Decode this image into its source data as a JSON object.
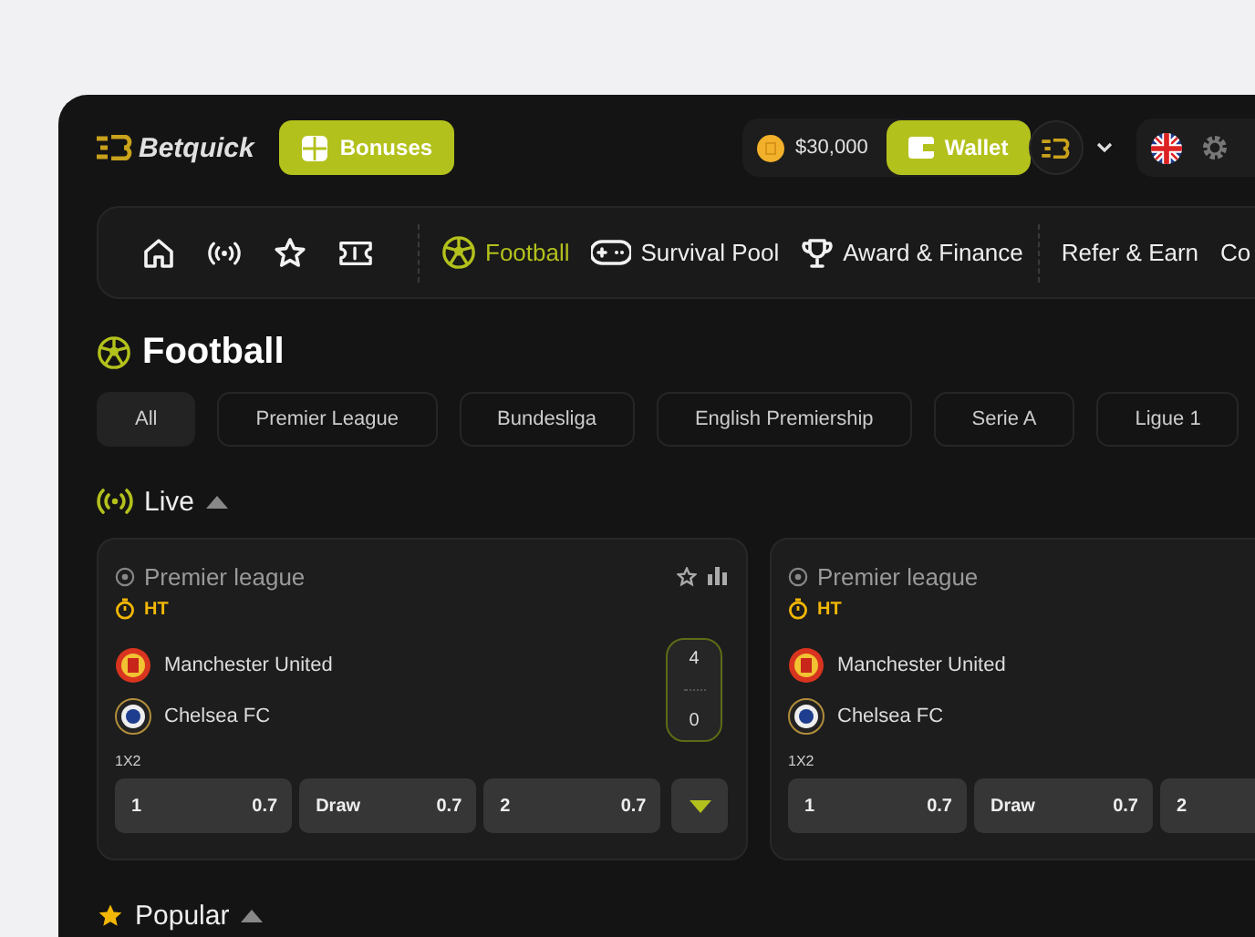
{
  "brand": {
    "name": "Betquick"
  },
  "header": {
    "bonuses_label": "Bonuses",
    "balance": "$30,000",
    "wallet_label": "Wallet"
  },
  "nav": {
    "icon_items": [
      {
        "kind": "home",
        "selected": false
      },
      {
        "kind": "live",
        "selected": false
      },
      {
        "kind": "star",
        "selected": false
      },
      {
        "kind": "ticket",
        "selected": false
      }
    ],
    "sport_items": [
      {
        "kind": "ball",
        "label": "Football",
        "selected": true
      },
      {
        "kind": "gamepad",
        "label": "Survival Pool",
        "selected": false
      },
      {
        "kind": "trophy",
        "label": "Award & Finance",
        "selected": false
      }
    ],
    "more_items": [
      {
        "label": "Refer & Earn",
        "selected": false
      },
      {
        "label": "Co",
        "selected": false
      }
    ]
  },
  "page_title": "Football",
  "leagues": [
    {
      "label": "All",
      "selected": true
    },
    {
      "label": "Premier League",
      "selected": false
    },
    {
      "label": "Bundesliga",
      "selected": false
    },
    {
      "label": "English Premiership",
      "selected": false
    },
    {
      "label": "Serie A",
      "selected": false
    },
    {
      "label": "Ligue 1",
      "selected": false
    }
  ],
  "sections": [
    {
      "kind": "live",
      "title": "Live",
      "expanded": true,
      "matches": [
        {
          "league": "Premier league",
          "status": "HT",
          "home": "Manchester United",
          "away": "Chelsea FC",
          "home_score": "4",
          "away_score": "0",
          "market": "1X2",
          "odds": [
            {
              "label": "1",
              "value": "0.7"
            },
            {
              "label": "Draw",
              "value": "0.7"
            },
            {
              "label": "2",
              "value": "0.7"
            }
          ],
          "more": true
        },
        {
          "league": "Premier league",
          "status": "HT",
          "home": "Manchester United",
          "away": "Chelsea FC",
          "market": "1X2",
          "odds": [
            {
              "label": "1",
              "value": "0.7"
            },
            {
              "label": "Draw",
              "value": "0.7"
            },
            {
              "label": "2"
            }
          ],
          "more": false
        }
      ]
    },
    {
      "kind": "popular",
      "title": "Popular",
      "expanded": true
    }
  ]
}
